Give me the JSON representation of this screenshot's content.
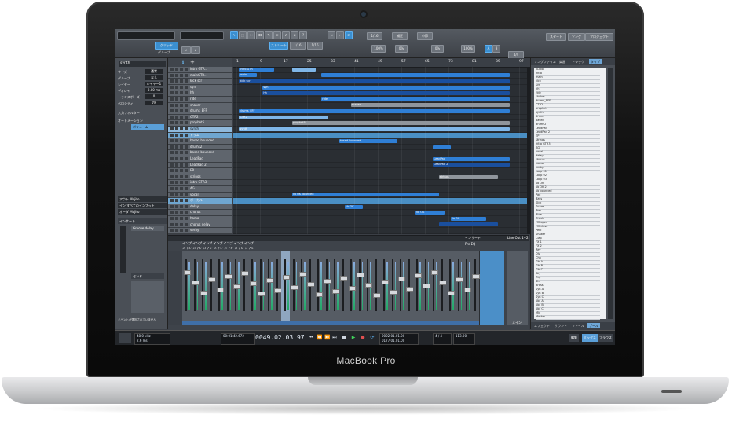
{
  "device": {
    "brand_label": "MacBook Pro"
  },
  "toolbar": {
    "groove_label": "グリッド",
    "groove_sub": "グルーブ",
    "tab_start": "ストレート",
    "val_1": "1/16",
    "val_2": "1/16",
    "mode_a": "1/16",
    "mode_b": "補正",
    "mode_c": "小節",
    "pct_1": "100%",
    "pct_2": "0%",
    "pct_3": "0%",
    "pct_4": "100%",
    "start_btn": "スタート",
    "song_btn": "ソング",
    "project_btn": "プロジェクト",
    "sig": "4/4"
  },
  "inspector": {
    "title": "synth",
    "rows": [
      {
        "label": "サイズ",
        "value": "通常"
      },
      {
        "label": "グループ",
        "value": "なし"
      },
      {
        "label": "レイヤー",
        "value": "レイヤー1"
      },
      {
        "label": "ディレイ",
        "value": "0.00 ms"
      },
      {
        "label": "トランスポーズ",
        "value": "0"
      },
      {
        "label": "ベロシティ",
        "value": "0%"
      }
    ],
    "sections": [
      "入力フィルター",
      "オートメーション"
    ],
    "volume_label": "ボリューム",
    "routing": [
      "アウト Mojito",
      "イン すべてのインプット",
      "オーダ Mojito"
    ],
    "device_label": "インサート",
    "delay_label": "Groove delay",
    "send_label": "センド",
    "empty_hint": "イベントが選択されていません"
  },
  "tracks": [
    {
      "name": "intro GTR...",
      "type": "normal"
    },
    {
      "name": "mainGTR...",
      "type": "normal"
    },
    {
      "name": "kick scr",
      "type": "normal"
    },
    {
      "name": "syn",
      "type": "normal"
    },
    {
      "name": "hh",
      "type": "normal"
    },
    {
      "name": "ride",
      "type": "normal"
    },
    {
      "name": "shaker",
      "type": "normal"
    },
    {
      "name": "drums_EFF",
      "type": "normal"
    },
    {
      "name": "CTR2",
      "type": "normal"
    },
    {
      "name": "prophet5",
      "type": "normal"
    },
    {
      "name": "synth",
      "type": "selected"
    },
    {
      "name": "ドラム",
      "type": "folder"
    },
    {
      "name": "based bounced",
      "type": "normal"
    },
    {
      "name": "drums2",
      "type": "normal"
    },
    {
      "name": "based bounced",
      "type": "normal"
    },
    {
      "name": "LeadPad",
      "type": "normal"
    },
    {
      "name": "LeadPad 2",
      "type": "normal"
    },
    {
      "name": "EP",
      "type": "normal"
    },
    {
      "name": "strings",
      "type": "normal"
    },
    {
      "name": "intro GTR3",
      "type": "normal"
    },
    {
      "name": "AG",
      "type": "normal"
    },
    {
      "name": "vocal",
      "type": "normal"
    },
    {
      "name": "ボーカル",
      "type": "folder"
    },
    {
      "name": "delay",
      "type": "normal"
    },
    {
      "name": "chorus",
      "type": "normal"
    },
    {
      "name": "hamo",
      "type": "normal"
    },
    {
      "name": "chorus delay",
      "type": "normal"
    },
    {
      "name": "verby",
      "type": "normal"
    }
  ],
  "ruler": [
    "1",
    "9",
    "17",
    "25",
    "33",
    "41",
    "49",
    "57",
    "65",
    "73",
    "81",
    "89",
    "97"
  ],
  "clips": [
    {
      "lane": 0,
      "start": 0.02,
      "len": 0.12,
      "color": "blue",
      "label": "intro GTR"
    },
    {
      "lane": 0,
      "start": 0.2,
      "len": 0.08,
      "color": "lblue",
      "label": ""
    },
    {
      "lane": 1,
      "start": 0.02,
      "len": 0.06,
      "color": "blue",
      "label": "main"
    },
    {
      "lane": 1,
      "start": 0.3,
      "len": 0.64,
      "color": "blue",
      "label": ""
    },
    {
      "lane": 2,
      "start": 0.02,
      "len": 0.92,
      "color": "dark",
      "label": "kick scr"
    },
    {
      "lane": 3,
      "start": 0.1,
      "len": 0.84,
      "color": "blue",
      "label": "syn"
    },
    {
      "lane": 4,
      "start": 0.1,
      "len": 0.84,
      "color": "dark",
      "label": "hh"
    },
    {
      "lane": 5,
      "start": 0.3,
      "len": 0.64,
      "color": "blue",
      "label": "ride"
    },
    {
      "lane": 6,
      "start": 0.4,
      "len": 0.54,
      "color": "gray",
      "label": "shaker"
    },
    {
      "lane": 7,
      "start": 0.02,
      "len": 0.92,
      "color": "blue",
      "label": "drums_EFF"
    },
    {
      "lane": 8,
      "start": 0.02,
      "len": 0.3,
      "color": "lblue",
      "label": "CTR2"
    },
    {
      "lane": 9,
      "start": 0.2,
      "len": 0.74,
      "color": "gray",
      "label": "prophet5"
    },
    {
      "lane": 10,
      "start": 0.02,
      "len": 0.92,
      "color": "lblue",
      "label": "synth"
    },
    {
      "lane": 12,
      "start": 0.36,
      "len": 0.2,
      "color": "blue",
      "label": "based bounced"
    },
    {
      "lane": 13,
      "start": 0.68,
      "len": 0.06,
      "color": "blue",
      "label": ""
    },
    {
      "lane": 15,
      "start": 0.68,
      "len": 0.26,
      "color": "blue",
      "label": "LeadPad"
    },
    {
      "lane": 16,
      "start": 0.68,
      "len": 0.26,
      "color": "dark",
      "label": "LeadPad 2"
    },
    {
      "lane": 18,
      "start": 0.7,
      "len": 0.2,
      "color": "gray",
      "label": "strings"
    },
    {
      "lane": 21,
      "start": 0.2,
      "len": 0.5,
      "color": "blue",
      "label": "Vo OK bounced"
    },
    {
      "lane": 23,
      "start": 0.38,
      "len": 0.06,
      "color": "blue",
      "label": "Vo OK"
    },
    {
      "lane": 24,
      "start": 0.62,
      "len": 0.1,
      "color": "blue",
      "label": "Vo OK"
    },
    {
      "lane": 25,
      "start": 0.74,
      "len": 0.12,
      "color": "blue",
      "label": "Vo OK"
    },
    {
      "lane": 26,
      "start": 0.7,
      "len": 0.2,
      "color": "dark",
      "label": ""
    }
  ],
  "browser": {
    "tabs": [
      "ソングファイル",
      "楽器",
      "トラック",
      "タイプ"
    ],
    "items": [
      "Audio",
      "intro",
      "main",
      "kick",
      "syn",
      "hh",
      "ride",
      "shaker",
      "drums_EFF",
      "CTR2",
      "prophet",
      "synth",
      "drums",
      "based",
      "drums2",
      "LeadPad",
      "LeadPad 2",
      "EP",
      "strings",
      "intro GTR3",
      "AG",
      "vocal",
      "delay",
      "chorus",
      "hamo",
      "verby",
      "Loop 01",
      "Loop 02",
      "Loop 03",
      "Vo OK",
      "Vo OK 2",
      "Vo bounced",
      "Pad",
      "Bass",
      "Kick",
      "Snare",
      "Tom",
      "Ride",
      "Crash",
      "HH open",
      "HH close",
      "Perc",
      "Shaker",
      "Clap",
      "FX 1",
      "FX 2",
      "Rev",
      "Dly",
      "Cho",
      "Gtr A",
      "Gtr B",
      "Gtr C",
      "Key",
      "Org",
      "Str",
      "Brass",
      "Syn A",
      "Syn B",
      "Syn C",
      "Vox A",
      "Vox B",
      "Vox C",
      "Mix",
      "Master"
    ],
    "bottom_tabs": [
      "エフェクト",
      "サウンド",
      "ファイル",
      "プール"
    ]
  },
  "mixer": {
    "header": "インサート",
    "rows": [
      "インプ インプ インプ インプ インプ インプ インプ",
      "メイン メイン メイン メイン メイン メイン メイン"
    ],
    "pre_eq": "Pre EQ",
    "out_label": "Line Out 1+2",
    "main_label": "メイン",
    "strip_count": 36
  },
  "transport": {
    "samplerate": "48.0 kHz",
    "latency": "2.6 ms",
    "perf_label": "パフォーマンス",
    "time": "00:01:42.672",
    "position": "0049.02.03.97",
    "loop_l": "0002.01.01.00",
    "loop_r": "0177.01.01.00",
    "sig": "4 / 4",
    "tempo": "113.00",
    "right_buttons": [
      "編集",
      "ミックス",
      "ブラウズ"
    ]
  }
}
